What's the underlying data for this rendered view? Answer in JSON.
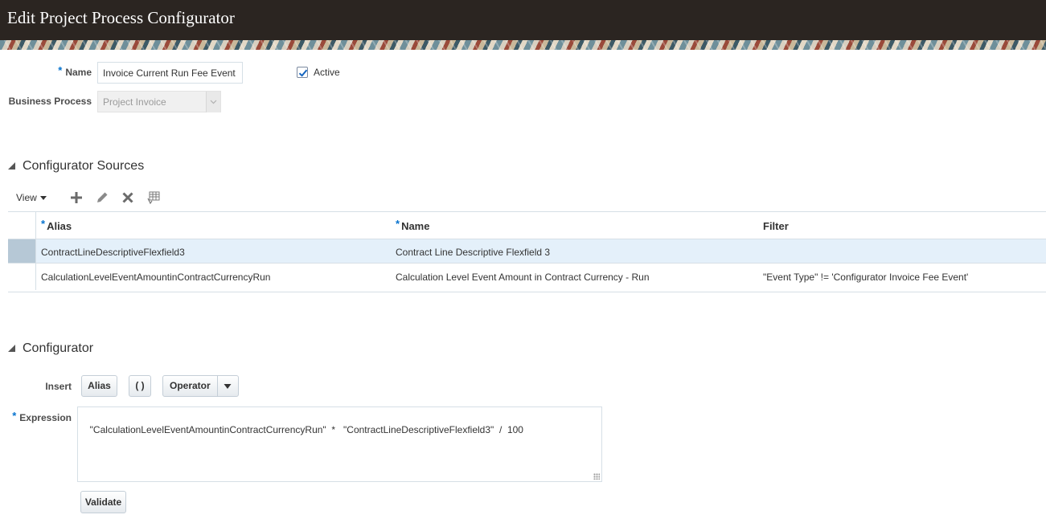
{
  "header": {
    "title": "Edit Project Process Configurator"
  },
  "form": {
    "name_label": "Name",
    "name_value": "Invoice Current Run Fee Event",
    "active_label": "Active",
    "active_checked": true,
    "business_process_label": "Business Process",
    "business_process_value": "Project Invoice"
  },
  "sources": {
    "title": "Configurator Sources",
    "toolbar": {
      "view_label": "View"
    },
    "columns": {
      "alias": "Alias",
      "name": "Name",
      "filter": "Filter"
    },
    "rows": [
      {
        "alias": "ContractLineDescriptiveFlexfield3",
        "name": "Contract Line Descriptive Flexfield 3",
        "filter": ""
      },
      {
        "alias": "CalculationLevelEventAmountinContractCurrencyRun",
        "name": "Calculation Level Event Amount in Contract Currency - Run",
        "filter": "\"Event Type\" != 'Configurator Invoice Fee Event'"
      }
    ]
  },
  "configurator": {
    "title": "Configurator",
    "insert_label": "Insert",
    "alias_button": "Alias",
    "parens_button": "( )",
    "operator_button": "Operator",
    "expression_label": "Expression",
    "expression_value": "\"CalculationLevelEventAmountinContractCurrencyRun\"  *   \"ContractLineDescriptiveFlexfield3\"  /  100",
    "validate_button": "Validate"
  }
}
